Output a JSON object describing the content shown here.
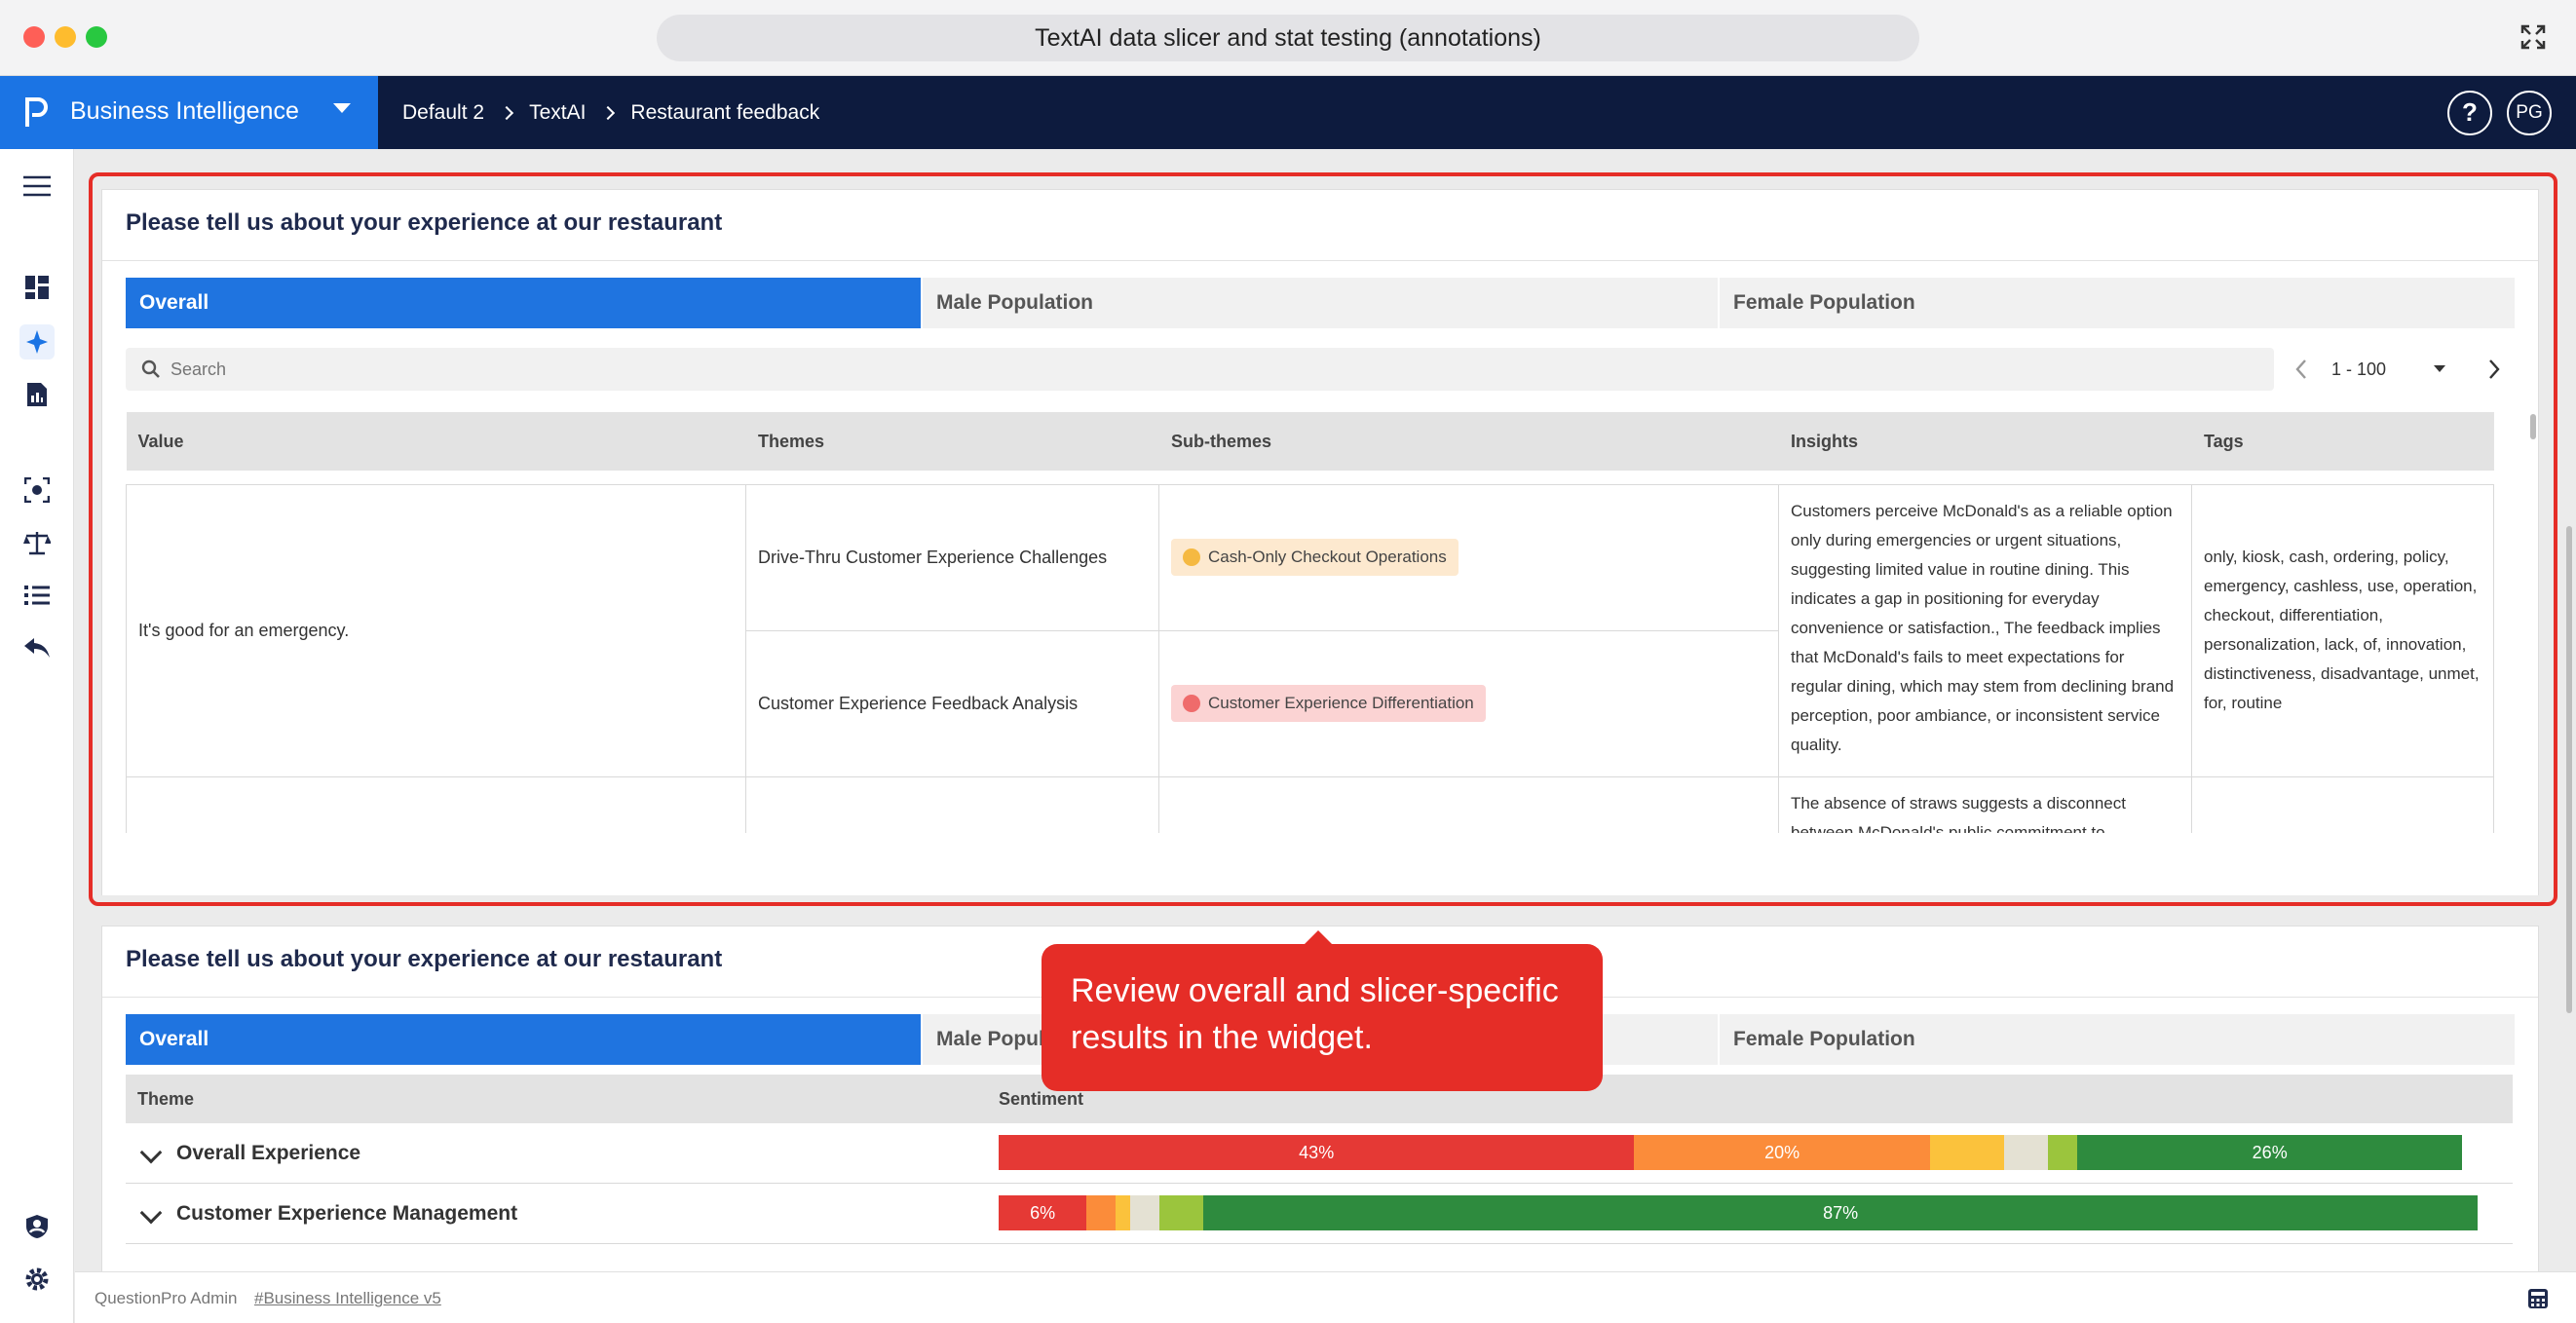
{
  "window": {
    "title": "TextAI data slicer and stat testing (annotations)"
  },
  "appbar": {
    "brand": "Business Intelligence",
    "breadcrumb": [
      "Default 2",
      "TextAI",
      "Restaurant feedback"
    ],
    "help_label": "?",
    "avatar_initials": "PG"
  },
  "widget1": {
    "title": "Please tell us about your experience at our restaurant",
    "tabs": [
      "Overall",
      "Male Population",
      "Female Population"
    ],
    "search_placeholder": "Search",
    "pager": "1 - 100",
    "columns": [
      "Value",
      "Themes",
      "Sub-themes",
      "Insights",
      "Tags"
    ],
    "rows": [
      {
        "value": "It's good for an emergency.",
        "themes": [
          "Drive-Thru Customer Experience Challenges",
          "Customer Experience Feedback Analysis"
        ],
        "subthemes": [
          {
            "label": "Cash-Only Checkout Operations",
            "sentiment": "neutral"
          },
          {
            "label": "Customer Experience Differentiation",
            "sentiment": "negative"
          }
        ],
        "insight": "Customers perceive McDonald's as a reliable option only during emergencies or urgent situations, suggesting limited value in routine dining. This indicates a gap in positioning for everyday convenience or satisfaction., The feedback implies that McDonald's fails to meet expectations for regular dining, which may stem from declining brand perception, poor ambiance, or inconsistent service quality.",
        "tags": "only, kiosk, cash, ordering, policy, emergency, cashless, use, operation, checkout, differentiation, personalization, lack, of, innovation, distinctiveness, disadvantage, unmet, for, routine"
      },
      {
        "value": "",
        "themes": [
          ""
        ],
        "subthemes": [],
        "insight": "The absence of straws suggests a disconnect between McDonald's public commitment to sustainability and actual operational practices.",
        "tags": ""
      }
    ]
  },
  "widget2": {
    "title": "Please tell us about your experience at our restaurant",
    "tabs": [
      "Overall",
      "Male Population",
      "Female Population"
    ],
    "columns": [
      "Theme",
      "Sentiment"
    ],
    "rows": [
      {
        "theme": "Overall Experience",
        "segments": [
          {
            "pct": 43,
            "label": "43%",
            "color": "#e53935"
          },
          {
            "pct": 20,
            "label": "20%",
            "color": "#fb8c3a"
          },
          {
            "pct": 5,
            "label": "",
            "color": "#fbc23c"
          },
          {
            "pct": 3,
            "label": "",
            "color": "#e4e1d3"
          },
          {
            "pct": 2,
            "label": "",
            "color": "#9bc53d"
          },
          {
            "pct": 26,
            "label": "26%",
            "color": "#2e8b3e"
          }
        ]
      },
      {
        "theme": "Customer Experience Management",
        "segments": [
          {
            "pct": 6,
            "label": "6%",
            "color": "#e53935"
          },
          {
            "pct": 2,
            "label": "",
            "color": "#fb8c3a"
          },
          {
            "pct": 1,
            "label": "",
            "color": "#fbc23c"
          },
          {
            "pct": 2,
            "label": "",
            "color": "#e4e1d3"
          },
          {
            "pct": 3,
            "label": "",
            "color": "#9bc53d"
          },
          {
            "pct": 87,
            "label": "87%",
            "color": "#2e8b3e"
          }
        ]
      }
    ]
  },
  "tooltip": {
    "text": "Review overall and slicer-specific results in the widget."
  },
  "footer": {
    "prefix": "QuestionPro Admin",
    "link": "#Business Intelligence v5"
  },
  "colors": {
    "brand": "#1b74e4",
    "navbar": "#0d1b3e",
    "highlight": "#e52d27"
  }
}
